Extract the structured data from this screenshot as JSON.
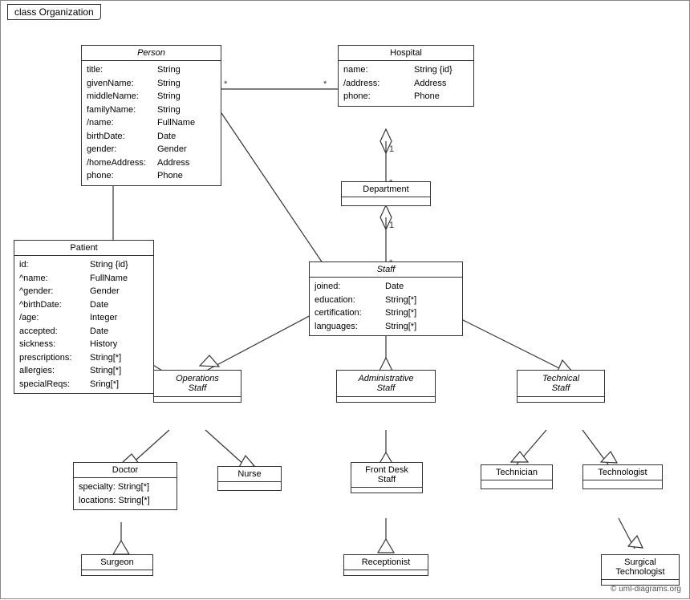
{
  "title": "class Organization",
  "classes": {
    "person": {
      "name": "Person",
      "italic": true,
      "attributes": [
        {
          "name": "title:",
          "type": "String"
        },
        {
          "name": "givenName:",
          "type": "String"
        },
        {
          "name": "middleName:",
          "type": "String"
        },
        {
          "name": "familyName:",
          "type": "String"
        },
        {
          "name": "/name:",
          "type": "FullName"
        },
        {
          "name": "birthDate:",
          "type": "Date"
        },
        {
          "name": "gender:",
          "type": "Gender"
        },
        {
          "name": "/homeAddress:",
          "type": "Address"
        },
        {
          "name": "phone:",
          "type": "Phone"
        }
      ]
    },
    "hospital": {
      "name": "Hospital",
      "italic": false,
      "attributes": [
        {
          "name": "name:",
          "type": "String {id}"
        },
        {
          "name": "/address:",
          "type": "Address"
        },
        {
          "name": "phone:",
          "type": "Phone"
        }
      ]
    },
    "patient": {
      "name": "Patient",
      "italic": false,
      "attributes": [
        {
          "name": "id:",
          "type": "String {id}"
        },
        {
          "name": "^name:",
          "type": "FullName"
        },
        {
          "name": "^gender:",
          "type": "Gender"
        },
        {
          "name": "^birthDate:",
          "type": "Date"
        },
        {
          "name": "/age:",
          "type": "Integer"
        },
        {
          "name": "accepted:",
          "type": "Date"
        },
        {
          "name": "sickness:",
          "type": "History"
        },
        {
          "name": "prescriptions:",
          "type": "String[*]"
        },
        {
          "name": "allergies:",
          "type": "String[*]"
        },
        {
          "name": "specialReqs:",
          "type": "Sring[*]"
        }
      ]
    },
    "department": {
      "name": "Department",
      "italic": false,
      "attributes": []
    },
    "staff": {
      "name": "Staff",
      "italic": true,
      "attributes": [
        {
          "name": "joined:",
          "type": "Date"
        },
        {
          "name": "education:",
          "type": "String[*]"
        },
        {
          "name": "certification:",
          "type": "String[*]"
        },
        {
          "name": "languages:",
          "type": "String[*]"
        }
      ]
    },
    "operations_staff": {
      "name": "Operations\nStaff",
      "italic": true,
      "attributes": []
    },
    "administrative_staff": {
      "name": "Administrative\nStaff",
      "italic": true,
      "attributes": []
    },
    "technical_staff": {
      "name": "Technical\nStaff",
      "italic": true,
      "attributes": []
    },
    "doctor": {
      "name": "Doctor",
      "italic": false,
      "attributes": [
        {
          "name": "specialty:",
          "type": "String[*]"
        },
        {
          "name": "locations:",
          "type": "String[*]"
        }
      ]
    },
    "nurse": {
      "name": "Nurse",
      "italic": false,
      "attributes": []
    },
    "front_desk_staff": {
      "name": "Front Desk\nStaff",
      "italic": false,
      "attributes": []
    },
    "technician": {
      "name": "Technician",
      "italic": false,
      "attributes": []
    },
    "technologist": {
      "name": "Technologist",
      "italic": false,
      "attributes": []
    },
    "surgeon": {
      "name": "Surgeon",
      "italic": false,
      "attributes": []
    },
    "receptionist": {
      "name": "Receptionist",
      "italic": false,
      "attributes": []
    },
    "surgical_technologist": {
      "name": "Surgical\nTechnologist",
      "italic": false,
      "attributes": []
    }
  },
  "copyright": "© uml-diagrams.org"
}
